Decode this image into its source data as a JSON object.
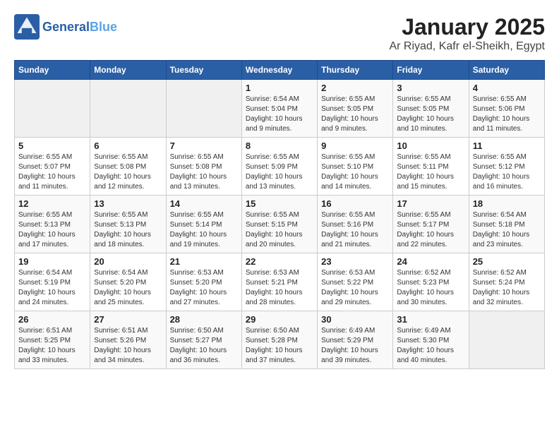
{
  "header": {
    "logo_general": "General",
    "logo_blue": "Blue",
    "title": "January 2025",
    "subtitle": "Ar Riyad, Kafr el-Sheikh, Egypt"
  },
  "days_of_week": [
    "Sunday",
    "Monday",
    "Tuesday",
    "Wednesday",
    "Thursday",
    "Friday",
    "Saturday"
  ],
  "weeks": [
    [
      {
        "day": "",
        "info": ""
      },
      {
        "day": "",
        "info": ""
      },
      {
        "day": "",
        "info": ""
      },
      {
        "day": "1",
        "info": "Sunrise: 6:54 AM\nSunset: 5:04 PM\nDaylight: 10 hours\nand 9 minutes."
      },
      {
        "day": "2",
        "info": "Sunrise: 6:55 AM\nSunset: 5:05 PM\nDaylight: 10 hours\nand 9 minutes."
      },
      {
        "day": "3",
        "info": "Sunrise: 6:55 AM\nSunset: 5:05 PM\nDaylight: 10 hours\nand 10 minutes."
      },
      {
        "day": "4",
        "info": "Sunrise: 6:55 AM\nSunset: 5:06 PM\nDaylight: 10 hours\nand 11 minutes."
      }
    ],
    [
      {
        "day": "5",
        "info": "Sunrise: 6:55 AM\nSunset: 5:07 PM\nDaylight: 10 hours\nand 11 minutes."
      },
      {
        "day": "6",
        "info": "Sunrise: 6:55 AM\nSunset: 5:08 PM\nDaylight: 10 hours\nand 12 minutes."
      },
      {
        "day": "7",
        "info": "Sunrise: 6:55 AM\nSunset: 5:08 PM\nDaylight: 10 hours\nand 13 minutes."
      },
      {
        "day": "8",
        "info": "Sunrise: 6:55 AM\nSunset: 5:09 PM\nDaylight: 10 hours\nand 13 minutes."
      },
      {
        "day": "9",
        "info": "Sunrise: 6:55 AM\nSunset: 5:10 PM\nDaylight: 10 hours\nand 14 minutes."
      },
      {
        "day": "10",
        "info": "Sunrise: 6:55 AM\nSunset: 5:11 PM\nDaylight: 10 hours\nand 15 minutes."
      },
      {
        "day": "11",
        "info": "Sunrise: 6:55 AM\nSunset: 5:12 PM\nDaylight: 10 hours\nand 16 minutes."
      }
    ],
    [
      {
        "day": "12",
        "info": "Sunrise: 6:55 AM\nSunset: 5:13 PM\nDaylight: 10 hours\nand 17 minutes."
      },
      {
        "day": "13",
        "info": "Sunrise: 6:55 AM\nSunset: 5:13 PM\nDaylight: 10 hours\nand 18 minutes."
      },
      {
        "day": "14",
        "info": "Sunrise: 6:55 AM\nSunset: 5:14 PM\nDaylight: 10 hours\nand 19 minutes."
      },
      {
        "day": "15",
        "info": "Sunrise: 6:55 AM\nSunset: 5:15 PM\nDaylight: 10 hours\nand 20 minutes."
      },
      {
        "day": "16",
        "info": "Sunrise: 6:55 AM\nSunset: 5:16 PM\nDaylight: 10 hours\nand 21 minutes."
      },
      {
        "day": "17",
        "info": "Sunrise: 6:55 AM\nSunset: 5:17 PM\nDaylight: 10 hours\nand 22 minutes."
      },
      {
        "day": "18",
        "info": "Sunrise: 6:54 AM\nSunset: 5:18 PM\nDaylight: 10 hours\nand 23 minutes."
      }
    ],
    [
      {
        "day": "19",
        "info": "Sunrise: 6:54 AM\nSunset: 5:19 PM\nDaylight: 10 hours\nand 24 minutes."
      },
      {
        "day": "20",
        "info": "Sunrise: 6:54 AM\nSunset: 5:20 PM\nDaylight: 10 hours\nand 25 minutes."
      },
      {
        "day": "21",
        "info": "Sunrise: 6:53 AM\nSunset: 5:20 PM\nDaylight: 10 hours\nand 27 minutes."
      },
      {
        "day": "22",
        "info": "Sunrise: 6:53 AM\nSunset: 5:21 PM\nDaylight: 10 hours\nand 28 minutes."
      },
      {
        "day": "23",
        "info": "Sunrise: 6:53 AM\nSunset: 5:22 PM\nDaylight: 10 hours\nand 29 minutes."
      },
      {
        "day": "24",
        "info": "Sunrise: 6:52 AM\nSunset: 5:23 PM\nDaylight: 10 hours\nand 30 minutes."
      },
      {
        "day": "25",
        "info": "Sunrise: 6:52 AM\nSunset: 5:24 PM\nDaylight: 10 hours\nand 32 minutes."
      }
    ],
    [
      {
        "day": "26",
        "info": "Sunrise: 6:51 AM\nSunset: 5:25 PM\nDaylight: 10 hours\nand 33 minutes."
      },
      {
        "day": "27",
        "info": "Sunrise: 6:51 AM\nSunset: 5:26 PM\nDaylight: 10 hours\nand 34 minutes."
      },
      {
        "day": "28",
        "info": "Sunrise: 6:50 AM\nSunset: 5:27 PM\nDaylight: 10 hours\nand 36 minutes."
      },
      {
        "day": "29",
        "info": "Sunrise: 6:50 AM\nSunset: 5:28 PM\nDaylight: 10 hours\nand 37 minutes."
      },
      {
        "day": "30",
        "info": "Sunrise: 6:49 AM\nSunset: 5:29 PM\nDaylight: 10 hours\nand 39 minutes."
      },
      {
        "day": "31",
        "info": "Sunrise: 6:49 AM\nSunset: 5:30 PM\nDaylight: 10 hours\nand 40 minutes."
      },
      {
        "day": "",
        "info": ""
      }
    ]
  ]
}
